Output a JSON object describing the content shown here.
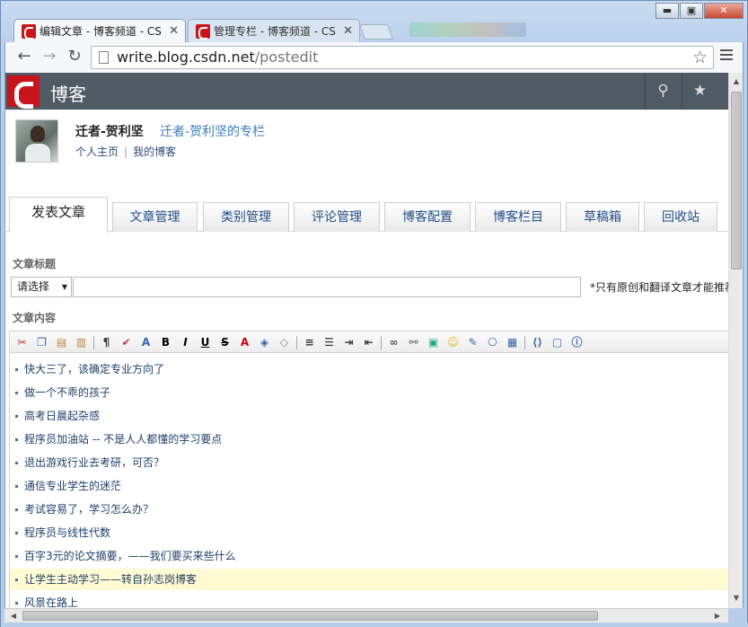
{
  "browser": {
    "tabs": [
      {
        "title": "编辑文章 - 博客频道 - CS",
        "active": true
      },
      {
        "title": "管理专栏 - 博客频道 - CS",
        "active": false
      }
    ],
    "window_buttons": {
      "minimize": "▬",
      "maximize": "▣",
      "close": "✕"
    },
    "url_host": "write.blog.csdn.net",
    "url_path": "/postedit",
    "icons": [
      "back-arrow-icon",
      "forward-arrow-icon",
      "reload-icon",
      "page-icon",
      "bookmark-star-icon",
      "menu-icon"
    ]
  },
  "site": {
    "brand": "博客",
    "accent": "#c8141a",
    "bar_color": "#4f5a64"
  },
  "profile": {
    "username": "迁者-贺利坚",
    "column": "迁者-贺利坚的专栏",
    "links": [
      "个人主页",
      "我的博客"
    ]
  },
  "tabs": [
    "发表文章",
    "文章管理",
    "类别管理",
    "评论管理",
    "博客配置",
    "博客栏目",
    "草稿箱",
    "回收站"
  ],
  "form": {
    "title_label": "文章标题",
    "type_select": "请选择",
    "title_value": "",
    "note": "*只有原创和翻译文章才能推荐",
    "content_label": "文章内容"
  },
  "editor": {
    "items": [
      "快大三了，该确定专业方向了",
      "做一个不乖的孩子",
      "高考日晨起杂感",
      "程序员加油站 -- 不是人人都懂的学习要点",
      "退出游戏行业去考研，可否？",
      "通信专业学生的迷茫",
      "考试容易了，学习怎么办？",
      "程序员与线性代数",
      "百字3元的论文摘要，——我们要买来些什么",
      "让学生主动学习——转自孙志岗博客",
      "风景在路上"
    ],
    "highlighted_index": 9
  }
}
